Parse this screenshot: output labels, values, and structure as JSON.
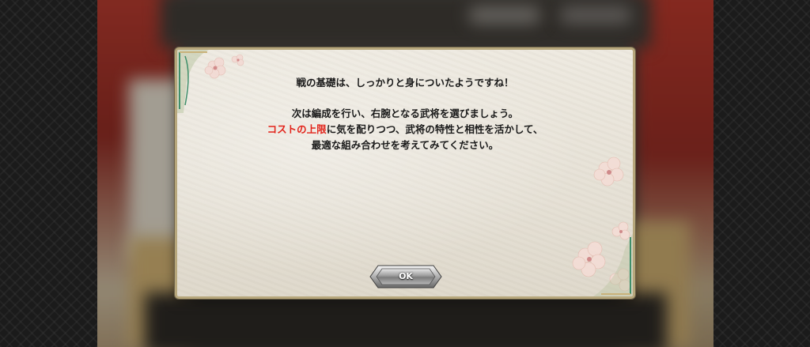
{
  "dialog": {
    "line1": "戦の基礎は、しっかりと身についたようですね！",
    "line2": "次は編成を行い、右腕となる武将を選びましょう。",
    "line3_highlight": "コストの上限",
    "line3_rest": "に気を配りつつ、武将の特性と相性を活かして、",
    "line4": "最適な組み合わせを考えてみてください。",
    "ok_label": "OK"
  },
  "colors": {
    "highlight": "#e2231a",
    "dialog_border": "#b7a77c",
    "jade_accent": "#3f8f6a"
  },
  "icons": [
    "cherry-blossom-icon",
    "ornate-corner-icon"
  ]
}
